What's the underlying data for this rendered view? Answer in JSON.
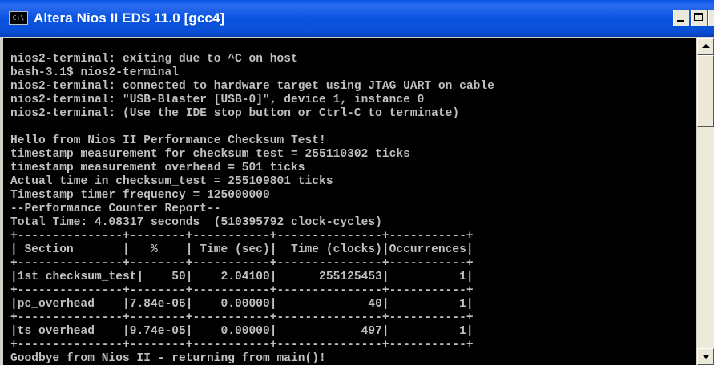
{
  "window": {
    "title": "Altera Nios II EDS 11.0 [gcc4]",
    "icon_label": "C:\\",
    "controls": {
      "minimize": "minimize-icon",
      "maximize": "maximize-icon",
      "close": "×"
    }
  },
  "console": {
    "lines": [
      "nios2-terminal: exiting due to ^C on host",
      "bash-3.1$ nios2-terminal",
      "nios2-terminal: connected to hardware target using JTAG UART on cable",
      "nios2-terminal: \"USB-Blaster [USB-0]\", device 1, instance 0",
      "nios2-terminal: (Use the IDE stop button or Ctrl-C to terminate)",
      "",
      "Hello from Nios II Performance Checksum Test!",
      "timestamp measurement for checksum_test = 255110302 ticks",
      "timestamp measurement overhead = 501 ticks",
      "Actual time in checksum_test = 255109801 ticks",
      "Timestamp timer frequency = 125000000",
      "--Performance Counter Report--",
      "Total Time: 4.08317 seconds  (510395792 clock-cycles)",
      "+---------------+--------+-----------+---------------+-----------+",
      "| Section       |   %    | Time (sec)|  Time (clocks)|Occurrences|",
      "+---------------+--------+-----------+---------------+-----------+",
      "|1st checksum_test|    50|    2.04100|      255125453|          1|",
      "+---------------+--------+-----------+---------------+-----------+",
      "|pc_overhead    |7.84e-06|    0.00000|             40|          1|",
      "+---------------+--------+-----------+---------------+-----------+",
      "|ts_overhead    |9.74e-05|    0.00000|            497|          1|",
      "+---------------+--------+-----------+---------------+-----------+",
      "Goodbye from Nios II - returning from main()!"
    ]
  },
  "colors": {
    "titlebar": "#0a54e6",
    "console_bg": "#000000",
    "console_text": "#c0c0c0"
  }
}
